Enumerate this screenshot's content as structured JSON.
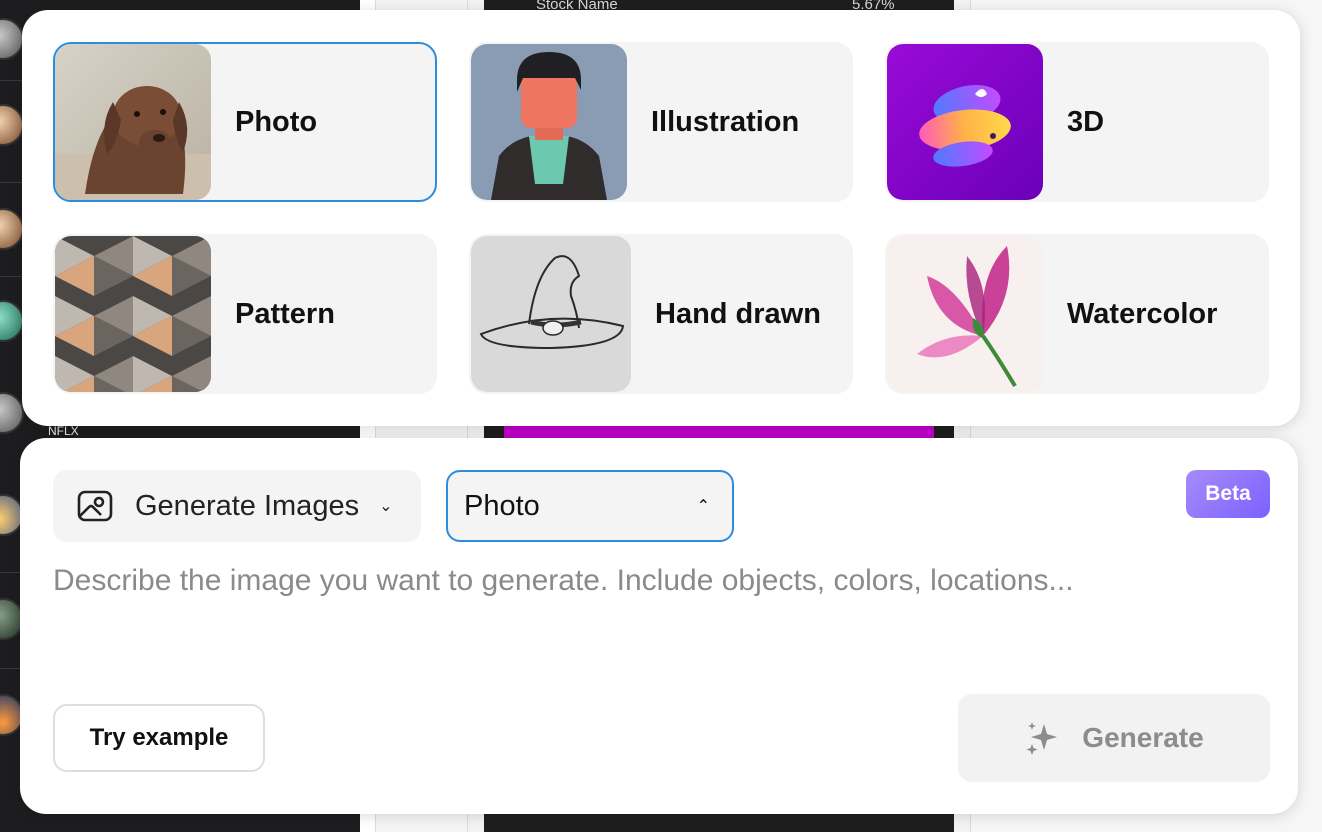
{
  "background": {
    "stock_label": "Stock Name",
    "stock_change": "5.67%",
    "ticker": "NFLX"
  },
  "style_picker": {
    "options": [
      {
        "label": "Photo",
        "icon": "dog-photo-thumbnail",
        "selected": true
      },
      {
        "label": "Illustration",
        "icon": "person-illustration-thumbnail",
        "selected": false
      },
      {
        "label": "3D",
        "icon": "3d-abstract-thumbnail",
        "selected": false
      },
      {
        "label": "Pattern",
        "icon": "geometric-pattern-thumbnail",
        "selected": false
      },
      {
        "label": "Hand drawn",
        "icon": "witch-hat-sketch-thumbnail",
        "selected": false
      },
      {
        "label": "Watercolor",
        "icon": "magnolia-watercolor-thumbnail",
        "selected": false
      }
    ]
  },
  "composer": {
    "mode_label": "Generate Images",
    "mode_icon": "image-icon",
    "selected_style": "Photo",
    "beta_label": "Beta",
    "prompt_value": "",
    "prompt_placeholder": "Describe the image you want to generate. Include objects, colors, locations...",
    "try_example_label": "Try example",
    "generate_label": "Generate",
    "generate_icon": "sparkle-icon"
  },
  "colors": {
    "accent": "#2b8de0",
    "beta_gradient_start": "#a78bfa",
    "beta_gradient_end": "#7b61ff",
    "card_bg": "#f4f4f4"
  }
}
